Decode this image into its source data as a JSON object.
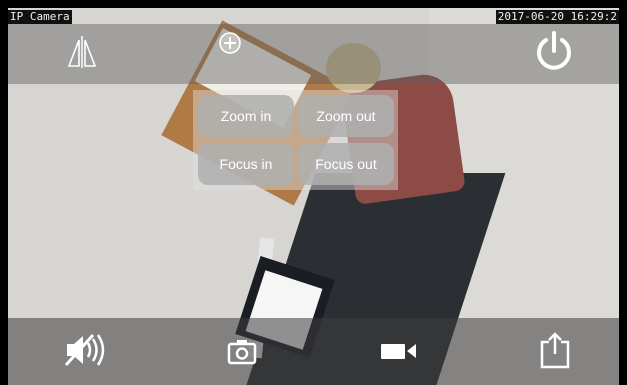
{
  "overlay": {
    "camera_name": "IP Camera",
    "timestamp": "2017-06-20 16:29:2"
  },
  "top_bar": {
    "icons": [
      "flip-icon",
      "zoom-plus-icon",
      "power-icon"
    ]
  },
  "zoom_panel": {
    "zoom_in": "Zoom in",
    "zoom_out": "Zoom out",
    "focus_in": "Focus in",
    "focus_out": "Focus out"
  },
  "bottom_bar": {
    "icons": [
      "mute-icon",
      "camera-icon",
      "video-record-icon",
      "share-icon"
    ]
  },
  "colors": {
    "icon": "#ffffff",
    "button": "#afafaf",
    "toolbar": "#5f5f5f"
  }
}
